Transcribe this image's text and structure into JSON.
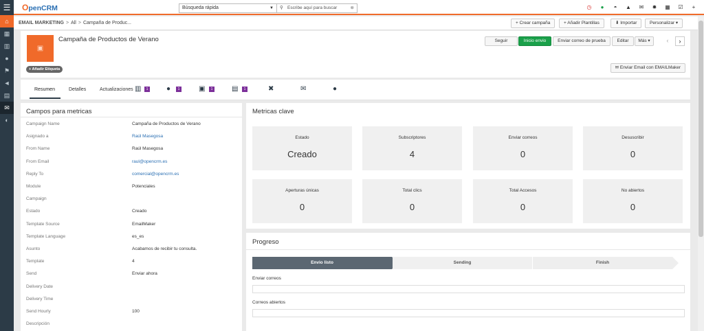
{
  "app": {
    "logo": "penCRM",
    "logo_initial": "O"
  },
  "sidebar": {
    "items": [
      {
        "name": "menu-icon",
        "glyph": "☰"
      },
      {
        "name": "home-icon",
        "glyph": "⌂"
      },
      {
        "name": "dashboard-icon",
        "glyph": "▦"
      },
      {
        "name": "building-icon",
        "glyph": "▥"
      },
      {
        "name": "person-icon",
        "glyph": "●"
      },
      {
        "name": "flag-icon",
        "glyph": "⚑"
      },
      {
        "name": "megaphone-icon",
        "glyph": "◄"
      },
      {
        "name": "grid-icon",
        "glyph": "▤"
      },
      {
        "name": "email-marketing-icon",
        "glyph": "✉"
      },
      {
        "name": "settings-icon",
        "glyph": "◐"
      }
    ]
  },
  "search": {
    "module": "Búsqueda rápida",
    "placeholder": "Escribe aquí para buscar"
  },
  "top_icons": [
    "clock-icon",
    "whatsapp-icon",
    "gauge-icon",
    "lock-icon",
    "mail-icon",
    "gear-icon",
    "calendar-icon",
    "check-icon",
    "add-icon"
  ],
  "breadcrumb": {
    "module": "EMAIL MARKETING",
    "all": "All",
    "record": "Campaña de Produc..."
  },
  "toolbar": {
    "create": "+ Crear campaña",
    "templates": "+ Añadir Plantillas",
    "import": "⬇ Importar",
    "customize": "Personalizar ▾"
  },
  "record": {
    "title": "Campaña de Productos de Verano",
    "tag_button": "+ Añadir Etiqueta"
  },
  "actions": {
    "follow": "Seguir",
    "start": "Inicio envio",
    "test": "Enviar correo de prueba",
    "edit": "Editar",
    "more": "Más ▾",
    "emailmaker": "Enviar Email con EMAILMaker"
  },
  "tabs": {
    "summary": "Resumen",
    "details": "Detalles",
    "updates": "Actualizaciones",
    "badge1": "1",
    "badge2": "1",
    "badge3": "1",
    "badge4": "1"
  },
  "fields_panel": {
    "title": "Campos para metricas",
    "rows": [
      {
        "label": "Campaign Name",
        "value": "Campaña de Productos de Verano",
        "link": false
      },
      {
        "label": "Asignado a",
        "value": "Raúl Masegosa",
        "link": true
      },
      {
        "label": "From Name",
        "value": "Raúl Masegosa",
        "link": false
      },
      {
        "label": "From Email",
        "value": "raul@opencrm.es",
        "link": true
      },
      {
        "label": "Reply To",
        "value": "comercial@opencrm.es",
        "link": true
      },
      {
        "label": "Module",
        "value": "Potenciales",
        "link": false
      },
      {
        "label": "Campaign",
        "value": "",
        "link": false
      },
      {
        "label": "Estado",
        "value": "Creado",
        "link": false
      },
      {
        "label": "Template Source",
        "value": "EmailMaker",
        "link": false
      },
      {
        "label": "Template Language",
        "value": "es_es",
        "link": false
      },
      {
        "label": "Asunto",
        "value": "Acabamos de recibir tu consulta.",
        "link": false
      },
      {
        "label": "Template",
        "value": "4",
        "link": false
      },
      {
        "label": "Send",
        "value": "Enviar ahora",
        "link": false
      },
      {
        "label": "Delivery Date",
        "value": "",
        "link": false
      },
      {
        "label": "Delivery Time",
        "value": "",
        "link": false
      },
      {
        "label": "Send Hourly",
        "value": "100",
        "link": false
      },
      {
        "label": "Descripción",
        "value": "",
        "link": false
      }
    ]
  },
  "metrics": {
    "title": "Metricas clave",
    "cards": [
      {
        "label": "Estado",
        "value": "Creado"
      },
      {
        "label": "Subscriptores",
        "value": "4"
      },
      {
        "label": "Enviar correos",
        "value": "0"
      },
      {
        "label": "Desuscribir",
        "value": "0"
      },
      {
        "label": "Aperturas únicas",
        "value": "0"
      },
      {
        "label": "Total clics",
        "value": "0"
      },
      {
        "label": "Total Accesos",
        "value": "0"
      },
      {
        "label": "No abiertos",
        "value": "0"
      }
    ]
  },
  "progress": {
    "title": "Progreso",
    "steps": [
      "Envio listo",
      "Sending",
      "Finish"
    ],
    "bar1_label": "Enviar correos",
    "bar2_label": "Correos abiertos"
  }
}
